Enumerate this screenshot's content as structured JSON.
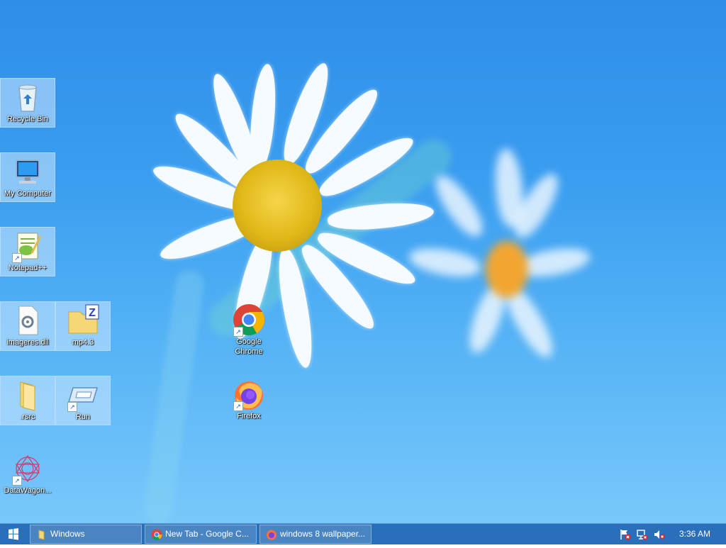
{
  "desktop": {
    "icons": [
      {
        "label": "Recycle Bin",
        "icon": "recycle-bin-icon"
      },
      {
        "label": "My Computer",
        "icon": "computer-icon"
      },
      {
        "label": "Notepad++",
        "icon": "notepad-plus-plus-icon"
      },
      {
        "label": "imageres.dll",
        "icon": "dll-file-icon"
      },
      {
        "label": "mp4.3",
        "icon": "zip-folder-icon"
      },
      {
        "label": ".rsrc",
        "icon": "folder-icon"
      },
      {
        "label": "Run",
        "icon": "run-icon"
      },
      {
        "label": "DataWagon...",
        "icon": "datawagon-icon"
      },
      {
        "label": "Google Chrome",
        "icon": "chrome-icon"
      },
      {
        "label": "Firefox",
        "icon": "firefox-icon"
      }
    ]
  },
  "taskbar": {
    "start_icon": "windows-logo-icon",
    "buttons": [
      {
        "label": "Windows",
        "icon": "folder-icon"
      },
      {
        "label": "New Tab - Google C...",
        "icon": "chrome-icon"
      },
      {
        "label": "windows 8 wallpaper...",
        "icon": "firefox-icon"
      }
    ],
    "tray": [
      "action-center-flag-icon",
      "network-icon",
      "volume-muted-icon"
    ],
    "clock": "3:36 AM"
  },
  "colors": {
    "wallpaper_top": "#2f8ee8",
    "wallpaper_bottom": "#79c8fb",
    "taskbar": "#2a6fb9"
  }
}
